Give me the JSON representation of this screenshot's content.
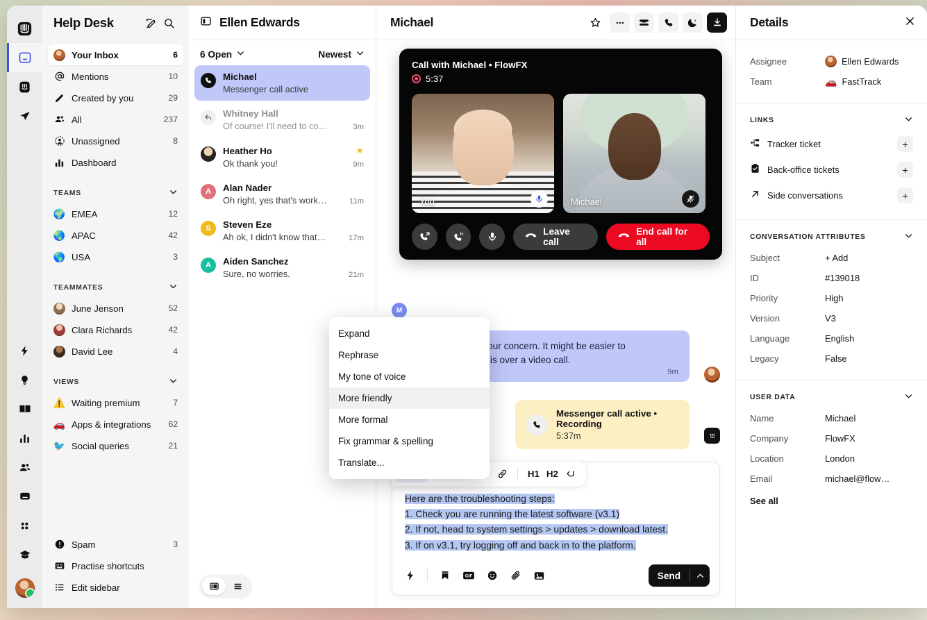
{
  "rail": {
    "icons": [
      {
        "name": "intercom-logo-icon",
        "label": "Intercom"
      },
      {
        "name": "inbox-icon",
        "label": "Inbox",
        "active": true
      },
      {
        "name": "messenger-icon",
        "label": "Messenger"
      },
      {
        "name": "send-icon",
        "label": "Outbound"
      }
    ],
    "bottom_icons": [
      {
        "name": "automation-bolt-icon",
        "label": "Automation"
      },
      {
        "name": "lightbulb-icon",
        "label": "Ideas"
      },
      {
        "name": "book-icon",
        "label": "Knowledge"
      },
      {
        "name": "reports-bar-icon",
        "label": "Reports"
      },
      {
        "name": "contacts-icon",
        "label": "Contacts"
      },
      {
        "name": "chat-icon",
        "label": "Messages"
      },
      {
        "name": "apps-grid-icon",
        "label": "Apps"
      },
      {
        "name": "academy-cap-icon",
        "label": "Academy"
      }
    ]
  },
  "sidebar": {
    "title": "Help Desk",
    "compose_icon": "compose-icon",
    "search_icon": "search-icon",
    "inbox_items": [
      {
        "label": "Your Inbox",
        "count": "6",
        "icon": "avatar-ellen",
        "selected": true
      },
      {
        "label": "Mentions",
        "count": "10",
        "icon": "mention-at-icon"
      },
      {
        "label": "Created by you",
        "count": "29",
        "icon": "pencil-icon"
      },
      {
        "label": "All",
        "count": "237",
        "icon": "people-icon"
      },
      {
        "label": "Unassigned",
        "count": "8",
        "icon": "unassigned-icon"
      },
      {
        "label": "Dashboard",
        "count": "",
        "icon": "bar-chart-icon"
      }
    ],
    "teams_header": "TEAMS",
    "teams": [
      {
        "label": "EMEA",
        "count": "12",
        "emoji": "🌍"
      },
      {
        "label": "APAC",
        "count": "42",
        "emoji": "🌏"
      },
      {
        "label": "USA",
        "count": "3",
        "emoji": "🌎"
      }
    ],
    "teammates_header": "TEAMMATES",
    "teammates": [
      {
        "label": "June Jenson",
        "count": "52",
        "avatar": "#c9a98c"
      },
      {
        "label": "Clara Richards",
        "count": "42",
        "avatar": "#c4685f"
      },
      {
        "label": "David Lee",
        "count": "4",
        "avatar": "#6b5345"
      }
    ],
    "views_header": "VIEWS",
    "views": [
      {
        "label": "Waiting premium",
        "count": "7",
        "emoji": "⚠️"
      },
      {
        "label": "Apps & integrations",
        "count": "62",
        "emoji": "🚗"
      },
      {
        "label": "Social queries",
        "count": "21",
        "emoji": "🐦"
      }
    ],
    "footer_items": [
      {
        "label": "Spam",
        "count": "3",
        "icon": "spam-icon"
      },
      {
        "label": "Practise shortcuts",
        "count": "",
        "icon": "keyboard-icon"
      },
      {
        "label": "Edit sidebar",
        "count": "",
        "icon": "list-icon"
      }
    ]
  },
  "conv_list": {
    "owner": "Ellen Edwards",
    "panel_icon": "panel-toggle-icon",
    "status_filter": "6 Open",
    "sort_filter": "Newest",
    "items": [
      {
        "name": "Michael",
        "preview": "Messenger call active",
        "time": "",
        "avatar_type": "phone",
        "avatar_color": "#111111",
        "initial": "",
        "starred": false,
        "active": true,
        "muted": false
      },
      {
        "name": "Whitney Hall",
        "preview": "Of course! I'll need to co…",
        "time": "3m",
        "avatar_type": "reply",
        "avatar_color": "#f0f0f0",
        "initial": "",
        "starred": false,
        "active": false,
        "muted": true
      },
      {
        "name": "Heather Ho",
        "preview": "Ok thank you!",
        "time": "9m",
        "avatar_type": "photo",
        "avatar_color": "#d7b49a",
        "initial": "",
        "starred": true,
        "active": false,
        "muted": false
      },
      {
        "name": "Alan Nader",
        "preview": "Oh right, yes that's work…",
        "time": "11m",
        "avatar_type": "initial",
        "avatar_color": "#e0707a",
        "initial": "A",
        "starred": false,
        "active": false,
        "muted": false
      },
      {
        "name": "Steven Eze",
        "preview": "Ah ok, I didn't know that…",
        "time": "17m",
        "avatar_type": "initial",
        "avatar_color": "#f0bb1e",
        "initial": "S",
        "starred": false,
        "active": false,
        "muted": false
      },
      {
        "name": "Aiden Sanchez",
        "preview": "Sure, no worries.",
        "time": "21m",
        "avatar_type": "initial",
        "avatar_color": "#16c0a0",
        "initial": "A",
        "starred": false,
        "active": false,
        "muted": false
      }
    ],
    "view_toggle": [
      "split-view-icon",
      "list-view-icon"
    ]
  },
  "main": {
    "title": "Michael",
    "actions": [
      {
        "name": "star-icon",
        "style": "plain"
      },
      {
        "name": "more-ellipsis-icon",
        "style": "chip"
      },
      {
        "name": "ticket-icon",
        "style": "chip"
      },
      {
        "name": "phone-icon",
        "style": "chip"
      },
      {
        "name": "snooze-moon-icon",
        "style": "chip"
      },
      {
        "name": "close-conversation-icon",
        "style": "dark"
      }
    ],
    "call": {
      "title": "Call with Michael • FlowFX",
      "duration": "5:37",
      "tiles": [
        {
          "name": "You",
          "mic": "on"
        },
        {
          "name": "Michael",
          "mic": "off"
        }
      ],
      "controls": [
        {
          "name": "transfer-call-icon",
          "type": "round"
        },
        {
          "name": "hold-call-icon",
          "type": "round"
        },
        {
          "name": "mute-mic-icon",
          "type": "round"
        }
      ],
      "leave_label": "Leave call",
      "end_label": "End call for all"
    },
    "messages": [
      {
        "author_initial": "M",
        "text": "I understand your concern. It might be easier to troubleshoot this over a video call.",
        "time": "9m",
        "side": "out"
      }
    ],
    "note": {
      "title": "Messenger call active • Recording",
      "subtitle": "5:37m",
      "icon": "phone-icon"
    },
    "ai_menu": {
      "items": [
        {
          "label": "Expand",
          "highlighted": false
        },
        {
          "label": "Rephrase",
          "highlighted": false
        },
        {
          "label": "My tone of voice",
          "highlighted": false
        },
        {
          "label": "More friendly",
          "highlighted": true
        },
        {
          "label": "More formal",
          "highlighted": false
        },
        {
          "label": "Fix grammar & spelling",
          "highlighted": false
        },
        {
          "label": "Translate...",
          "highlighted": false
        }
      ]
    },
    "composer": {
      "ai_tag": "AI",
      "toolbar": [
        {
          "name": "bold-button",
          "label": "B"
        },
        {
          "name": "italic-button",
          "label": "i"
        },
        {
          "name": "code-button",
          "label": "</>"
        },
        {
          "name": "link-button",
          "label": "link"
        },
        {
          "name": "h1-button",
          "label": "H1"
        },
        {
          "name": "h2-button",
          "label": "H2"
        },
        {
          "name": "snippet-button",
          "label": "snippet"
        }
      ],
      "lines": [
        "Here are the troubleshooting steps:",
        "1. Check you are running the latest software (v3.1)",
        "2. If not, head to system settings > updates > download latest.",
        "3. If on v3.1, try logging off and back in to the platform."
      ],
      "footer_icons": [
        "shortcut-bolt-icon",
        "saved-reply-icon",
        "gif-icon",
        "emoji-icon",
        "attachment-icon",
        "image-icon"
      ],
      "send_label": "Send",
      "send_caret": "caret-up-icon"
    }
  },
  "details": {
    "title": "Details",
    "close_icon": "close-icon",
    "assignment": [
      {
        "key": "Assignee",
        "value": "Ellen Edwards",
        "avatar": "photo"
      },
      {
        "key": "Team",
        "value": "FastTrack",
        "avatar": "🚗"
      }
    ],
    "links_header": "LINKS",
    "links": [
      {
        "label": "Tracker ticket",
        "icon": "tracker-icon"
      },
      {
        "label": "Back-office tickets",
        "icon": "clipboard-icon"
      },
      {
        "label": "Side conversations",
        "icon": "arrow-out-icon"
      }
    ],
    "attributes_header": "CONVERSATION ATTRIBUTES",
    "attributes": [
      {
        "key": "Subject",
        "value": "+ Add"
      },
      {
        "key": "ID",
        "value": "#139018"
      },
      {
        "key": "Priority",
        "value": "High"
      },
      {
        "key": "Version",
        "value": "V3"
      },
      {
        "key": "Language",
        "value": "English"
      },
      {
        "key": "Legacy",
        "value": "False"
      }
    ],
    "userdata_header": "USER DATA",
    "userdata": [
      {
        "key": "Name",
        "value": "Michael"
      },
      {
        "key": "Company",
        "value": "FlowFX"
      },
      {
        "key": "Location",
        "value": "London"
      },
      {
        "key": "Email",
        "value": "michael@flow…"
      }
    ],
    "see_all": "See all"
  }
}
